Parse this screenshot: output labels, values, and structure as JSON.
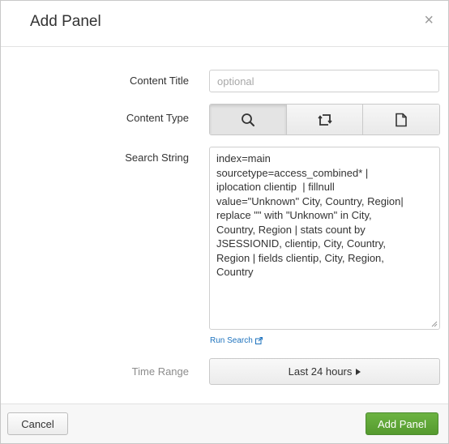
{
  "dialog": {
    "title": "Add Panel",
    "close_glyph": "×"
  },
  "form": {
    "content_title": {
      "label": "Content Title",
      "value": "",
      "placeholder": "optional"
    },
    "content_type": {
      "label": "Content Type",
      "options": [
        {
          "icon": "search-icon",
          "selected": true
        },
        {
          "icon": "pivot-icon",
          "selected": false
        },
        {
          "icon": "document-icon",
          "selected": false
        }
      ]
    },
    "search_string": {
      "label": "Search String",
      "value": "index=main\nsourcetype=access_combined* |\niplocation clientip  | fillnull\nvalue=\"Unknown\" City, Country, Region|\nreplace \"\" with \"Unknown\" in City,\nCountry, Region | stats count by\nJSESSIONID, clientip, City, Country,\nRegion | fields clientip, City, Region,\nCountry"
    },
    "run_search": {
      "label": "Run Search",
      "icon": "external-link-icon"
    },
    "time_range": {
      "label": "Time Range",
      "value": "Last 24 hours",
      "icon": "caret-right-icon"
    }
  },
  "footer": {
    "cancel_label": "Cancel",
    "add_label": "Add Panel"
  },
  "colors": {
    "primary": "#5aa334",
    "link": "#1e73be"
  }
}
